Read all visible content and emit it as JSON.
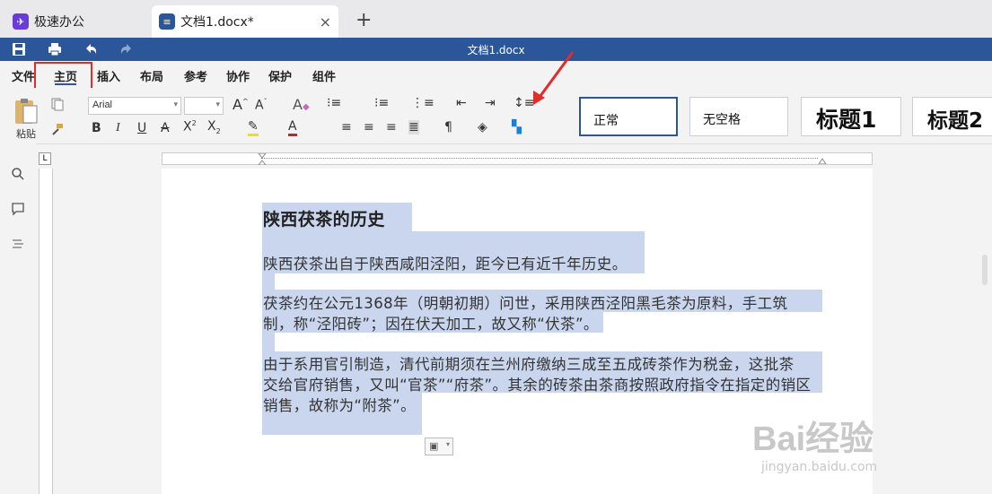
{
  "tabs": {
    "home_label": "极速办公",
    "doc_label": "文档1.docx*",
    "close_icon": "×",
    "add_icon": "+"
  },
  "titlebar": {
    "title": "文档1.docx"
  },
  "menu": {
    "file": "文件",
    "home": "主页",
    "insert": "插入",
    "layout": "布局",
    "reference": "参考",
    "collab": "协作",
    "protect": "保护",
    "plugins": "组件"
  },
  "ribbon": {
    "paste_label": "粘贴",
    "font_name": "Arial",
    "font_size": "",
    "styles": [
      "正常",
      "无空格",
      "标题1",
      "标题2"
    ]
  },
  "document": {
    "heading": "陕西茯茶的历史",
    "p1": "陕西茯茶出自于陕西咸阳泾阳，距今已有近千年历史。",
    "p2_l1": "茯茶约在公元1368年（明朝初期）问世，采用陕西泾阳黑毛茶为原料，手工筑",
    "p2_l2": "制，称“泾阳砖”；因在伏天加工，故又称“伏茶”。",
    "p3_l1": "由于系用官引制造，清代前期须在兰州府缴纳三成至五成砖茶作为税金，这批茶",
    "p3_l2": "交给官府销售，又叫“官茶”“府茶”。其余的砖茶由茶商按照政府指令在指定的销区",
    "p3_l3": "销售，故称为“附茶”。"
  },
  "ruler": {
    "corner": "L"
  },
  "watermark": {
    "brand": "Bai经验",
    "url": "jingyan.baidu.com"
  },
  "colors": {
    "titlebar": "#2b579a",
    "highlight": "#c9d6ee",
    "annotation": "#e22b2b"
  }
}
